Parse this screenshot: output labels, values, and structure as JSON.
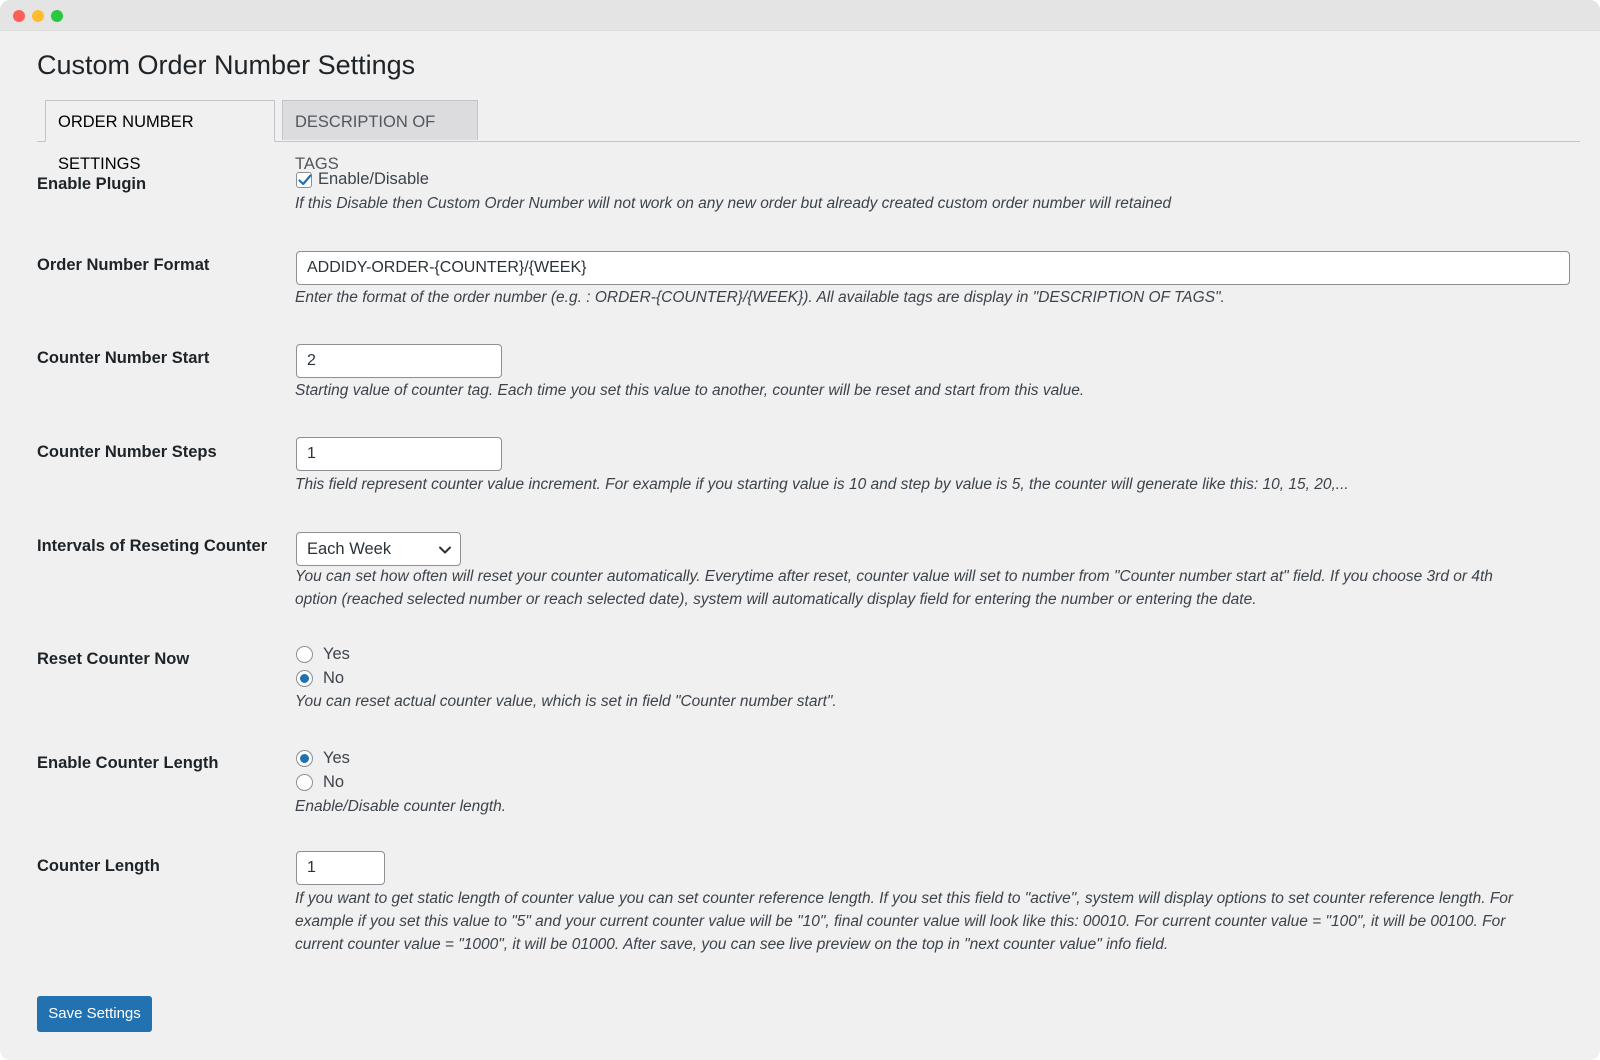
{
  "page": {
    "title": "Custom Order Number Settings"
  },
  "tabs": [
    {
      "label": "ORDER NUMBER SETTINGS",
      "active": true
    },
    {
      "label": "DESCRIPTION OF TAGS",
      "active": false
    }
  ],
  "fields": {
    "enable_plugin": {
      "label": "Enable Plugin",
      "checkbox_label": "Enable/Disable",
      "checked": true,
      "description": "If this Disable then Custom Order Number will not work on any new order but already created custom order number will retained"
    },
    "order_number_format": {
      "label": "Order Number Format",
      "value": "ADDIDY-ORDER-{COUNTER}/{WEEK}",
      "description": "Enter the format of the order number (e.g. : ORDER-{COUNTER}/{WEEK}). All available tags are display in \"DESCRIPTION OF TAGS\"."
    },
    "counter_start": {
      "label": "Counter Number Start",
      "value": "2",
      "description": "Starting value of counter tag. Each time you set this value to another, counter will be reset and start from this value."
    },
    "counter_steps": {
      "label": "Counter Number Steps",
      "value": "1",
      "description": "This field represent counter value increment. For example if you starting value is 10 and step by value is 5, the counter will generate like this: 10, 15, 20,..."
    },
    "reset_interval": {
      "label": "Intervals of Reseting Counter",
      "selected": "Each Week",
      "description_line1": "You can set how often will reset your counter automatically. Everytime after reset, counter value will set to number from \"Counter number start at\" field. If you choose 3rd or 4th",
      "description_line2": "option (reached selected number or reach selected date), system will automatically display field for entering the number or entering the date."
    },
    "reset_now": {
      "label": "Reset Counter Now",
      "options": [
        {
          "label": "Yes",
          "checked": false
        },
        {
          "label": "No",
          "checked": true
        }
      ],
      "description": "You can reset actual counter value, which is set in field \"Counter number start\"."
    },
    "enable_counter_length": {
      "label": "Enable Counter Length",
      "options": [
        {
          "label": "Yes",
          "checked": true
        },
        {
          "label": "No",
          "checked": false
        }
      ],
      "description": "Enable/Disable counter length."
    },
    "counter_length": {
      "label": "Counter Length",
      "value": "1",
      "description_line1": "If you want to get static length of counter value you can set counter reference length. If you set this field to \"active\", system will display options to set counter reference length. For",
      "description_line2": "example if you set this value to \"5\" and your current counter value will be \"10\", final counter value will look like this: 00010. For current counter value = \"100\", it will be 00100. For",
      "description_line3": "current counter value = \"1000\", it will be 01000. After save, you can see live preview on the top in \"next counter value\" info field."
    }
  },
  "actions": {
    "save_label": "Save Settings"
  },
  "colors": {
    "accent": "#2271b1",
    "background": "#f0f0f1"
  }
}
